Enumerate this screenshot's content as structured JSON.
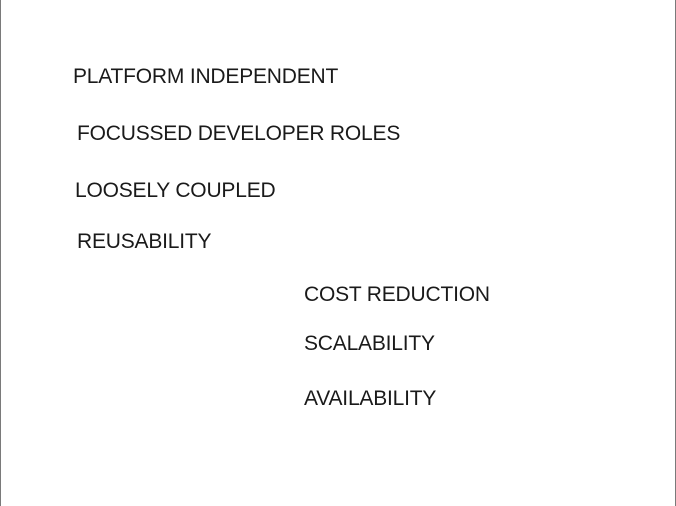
{
  "slide": {
    "items": [
      "PLATFORM INDEPENDENT",
      "FOCUSSED DEVELOPER ROLES",
      "LOOSELY COUPLED",
      "REUSABILITY",
      "COST REDUCTION",
      "SCALABILITY",
      "AVAILABILITY"
    ]
  }
}
